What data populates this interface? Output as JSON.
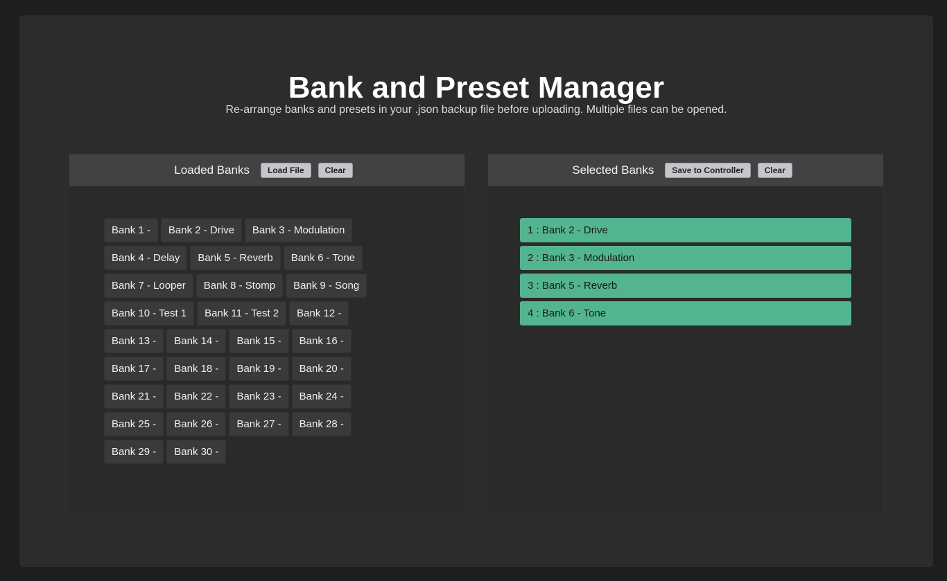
{
  "header": {
    "title": "Bank and Preset Manager",
    "subtitle": "Re-arrange banks and presets in your .json backup file before uploading. Multiple files can be opened."
  },
  "loaded_panel": {
    "title": "Loaded Banks",
    "load_label": "Load File",
    "clear_label": "Clear",
    "banks": [
      "Bank 1 -",
      "Bank 2 - Drive",
      "Bank 3 - Modulation",
      "Bank 4 - Delay",
      "Bank 5 - Reverb",
      "Bank 6 - Tone",
      "Bank 7 - Looper",
      "Bank 8 - Stomp",
      "Bank 9 - Song",
      "Bank 10 - Test 1",
      "Bank 11 - Test 2",
      "Bank 12 -",
      "Bank 13 -",
      "Bank 14 -",
      "Bank 15 -",
      "Bank 16 -",
      "Bank 17 -",
      "Bank 18 -",
      "Bank 19 -",
      "Bank 20 -",
      "Bank 21 -",
      "Bank 22 -",
      "Bank 23 -",
      "Bank 24 -",
      "Bank 25 -",
      "Bank 26 -",
      "Bank 27 -",
      "Bank 28 -",
      "Bank 29 -",
      "Bank 30 -"
    ]
  },
  "selected_panel": {
    "title": "Selected Banks",
    "save_label": "Save to Controller",
    "clear_label": "Clear",
    "items": [
      "1 : Bank 2 - Drive",
      "2 : Bank 3 - Modulation",
      "3 : Bank 5 - Reverb",
      "4 : Bank 6 - Tone"
    ]
  },
  "colors": {
    "selected_item": "#52b58f",
    "bank_button": "#3a3a3a",
    "header_bar": "#424242"
  }
}
